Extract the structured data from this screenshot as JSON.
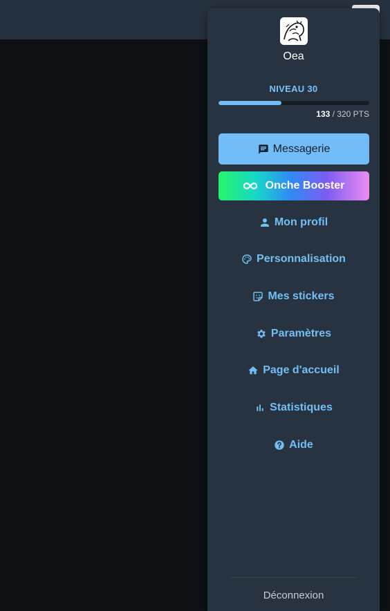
{
  "user": {
    "name": "Oea",
    "level_label": "NIVEAU 30",
    "points_current": "133",
    "points_rest": " / 320 PTS",
    "progress_fraction": 0.416
  },
  "buttons": {
    "messagerie": "Messagerie",
    "booster": "Onche Booster"
  },
  "menu": {
    "profile": "Mon profil",
    "personalisation": "Personnalisation",
    "stickers": "Mes stickers",
    "settings": "Paramètres",
    "homepage": "Page d'accueil",
    "stats": "Statistiques",
    "help": "Aide"
  },
  "logout": "Déconnexion",
  "icons": {
    "messagerie": "chat-bubble-icon",
    "booster": "infinity-icon",
    "profile": "person-icon",
    "personalisation": "palette-icon",
    "stickers": "sticker-icon",
    "settings": "gear-icon",
    "homepage": "home-icon",
    "stats": "bar-chart-icon",
    "help": "help-circle-icon"
  },
  "colors": {
    "panel": "#273341",
    "accent": "#73bff4",
    "messagerie_bg": "#72bdf7"
  }
}
